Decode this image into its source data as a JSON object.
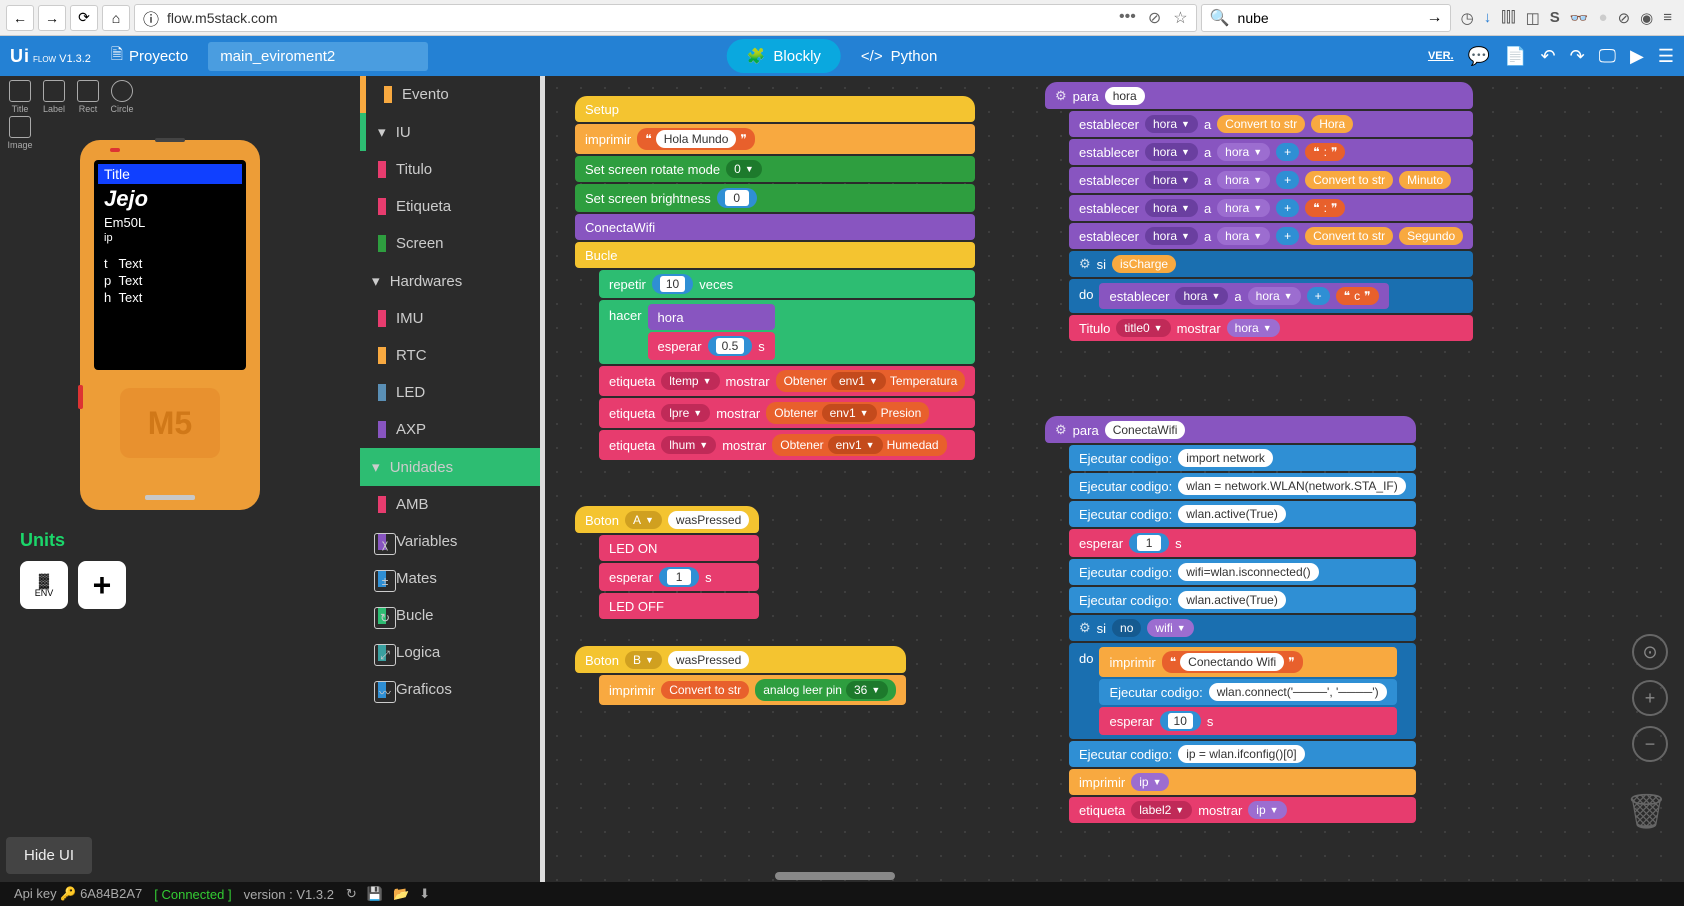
{
  "browser": {
    "url": "flow.m5stack.com",
    "search": "nube"
  },
  "app": {
    "logo": "Ui",
    "logoSub": "FLOW",
    "version": "V1.3.2",
    "project_label": "Proyecto",
    "project_name": "main_eviroment2",
    "tab_blockly": "Blockly",
    "tab_python": "Python",
    "ver_icon": "VER."
  },
  "tools": {
    "title": "Title",
    "label": "Label",
    "rect": "Rect",
    "circle": "Circle",
    "image": "Image"
  },
  "device": {
    "title": "Title",
    "jejo": "Jejo",
    "model": "Em50L",
    "ip": "ip",
    "t": "t",
    "p": "p",
    "h": "h",
    "text": "Text",
    "m5": "M5"
  },
  "units": {
    "label": "Units",
    "env": "ENV"
  },
  "categories": {
    "evento": "Evento",
    "iu": "IU",
    "titulo": "Titulo",
    "etiqueta": "Etiqueta",
    "screen": "Screen",
    "hardwares": "Hardwares",
    "imu": "IMU",
    "rtc": "RTC",
    "led": "LED",
    "axp": "AXP",
    "unidades": "Unidades",
    "amb": "AMB",
    "variables": "Variables",
    "mates": "Mates",
    "bucle": "Bucle",
    "logica": "Logica",
    "graficos": "Graficos"
  },
  "blocks": {
    "setup": "Setup",
    "imprimir": "imprimir",
    "hola": "Hola Mundo",
    "set_rotate": "Set screen rotate mode",
    "rotate_val": "0",
    "set_bright": "Set screen brightness",
    "bright_val": "0",
    "conecta": "ConectaWifi",
    "bucle": "Bucle",
    "repetir": "repetir",
    "repetir_val": "10",
    "veces": "veces",
    "hacer": "hacer",
    "hora": "hora",
    "esperar": "esperar",
    "wait05": "0.5",
    "s": "s",
    "etiqueta": "etiqueta",
    "ltemp": "ltemp",
    "lpre": "lpre",
    "lhum": "lhum",
    "mostrar": "mostrar",
    "obtener": "Obtener",
    "env1": "env1",
    "temperatura": "Temperatura",
    "presion": "Presion",
    "humedad": "Humedad",
    "boton": "Boton",
    "A": "A",
    "B": "B",
    "wasPressed": "wasPressed",
    "ledon": "LED ON",
    "ledoff": "LED OFF",
    "wait1": "1",
    "convert_str": "Convert to str",
    "analog_pin": "analog leer pin",
    "pin36": "36",
    "para": "para",
    "establecer": "establecer",
    "a": "a",
    "Hora": "Hora",
    "Minuto": "Minuto",
    "Segundo": "Segundo",
    "colon": ":",
    "plus": "+",
    "si": "si",
    "do": "do",
    "isCharge": "isCharge",
    "c": "c",
    "titulo_b": "Titulo",
    "title0": "title0",
    "ejecutar": "Ejecutar codigo:",
    "import_network": "import network",
    "wlan_def": "wlan = network.WLAN(network.STA_IF)",
    "wlan_active": "wlan.active(True)",
    "wifi_isconn": "wifi=wlan.isconnected()",
    "no": "no",
    "wifi": "wifi",
    "conectando": "Conectando Wifi",
    "wlan_connect": "wlan.connect('────', '────')",
    "wait10": "10",
    "ip_config": "ip = wlan.ifconfig()[0]",
    "ip": "ip",
    "label2": "label2"
  },
  "ui": {
    "hide": "Hide UI"
  },
  "status": {
    "api_key_label": "Api key",
    "api_key": "6A84B2A7",
    "connected": "Connected",
    "version_label": "version : V1.3.2"
  }
}
